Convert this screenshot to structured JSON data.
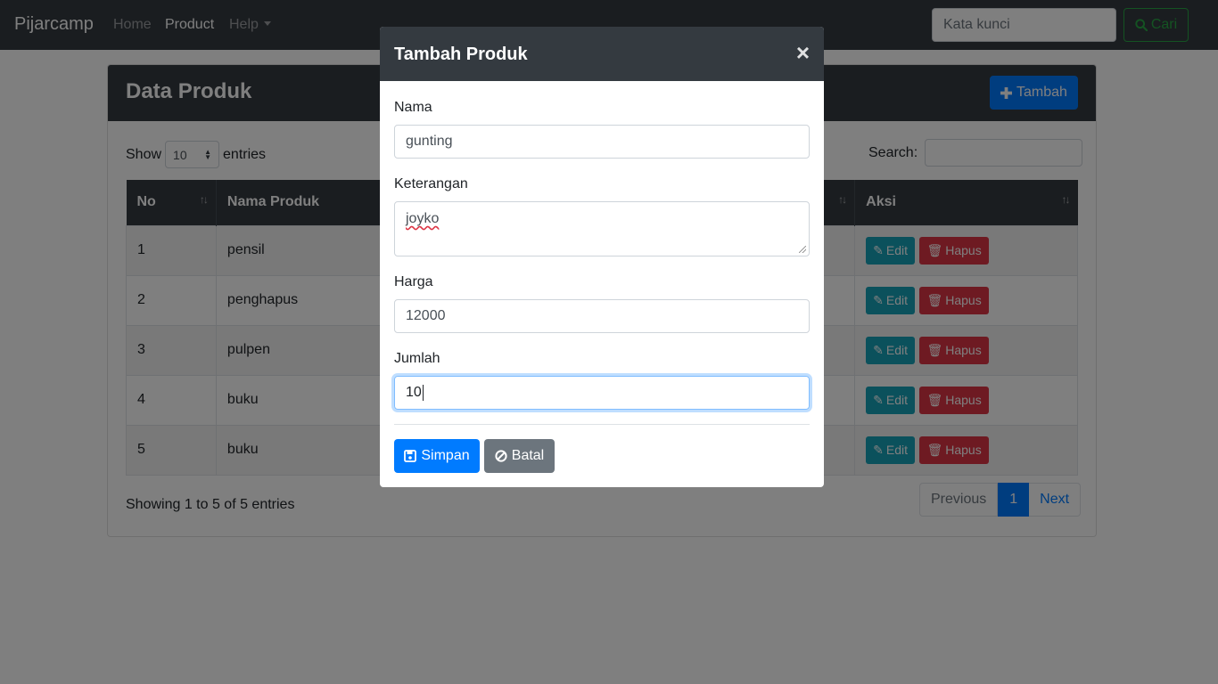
{
  "navbar": {
    "brand": "Pijarcamp",
    "links": [
      "Home",
      "Product",
      "Help"
    ],
    "search_placeholder": "Kata kunci",
    "search_button": "Cari"
  },
  "card": {
    "title": "Data Produk",
    "add_button": "Tambah",
    "show_label": "Show",
    "entries_value": "10",
    "entries_label": "entries",
    "search_label": "Search:",
    "columns": [
      "No",
      "Nama Produk",
      "Aksi"
    ],
    "rows": [
      {
        "no": "1",
        "nama": "pensil"
      },
      {
        "no": "2",
        "nama": "penghapus"
      },
      {
        "no": "3",
        "nama": "pulpen"
      },
      {
        "no": "4",
        "nama": "buku"
      },
      {
        "no": "5",
        "nama": "buku"
      }
    ],
    "edit_label": "Edit",
    "delete_label": "Hapus",
    "info": "Showing 1 to 5 of 5 entries",
    "pagination": {
      "previous": "Previous",
      "current": "1",
      "next": "Next"
    }
  },
  "modal": {
    "title": "Tambah Produk",
    "close": "×",
    "fields": {
      "nama_label": "Nama",
      "nama_value": "gunting",
      "keterangan_label": "Keterangan",
      "keterangan_value": "joyko",
      "harga_label": "Harga",
      "harga_value": "12000",
      "jumlah_label": "Jumlah",
      "jumlah_value": "10"
    },
    "save_button": "Simpan",
    "cancel_button": "Batal"
  },
  "colors": {
    "dark": "#343a40",
    "primary": "#007bff",
    "success": "#28a745",
    "info": "#17a2b8",
    "danger": "#dc3545",
    "secondary": "#6c757d"
  }
}
